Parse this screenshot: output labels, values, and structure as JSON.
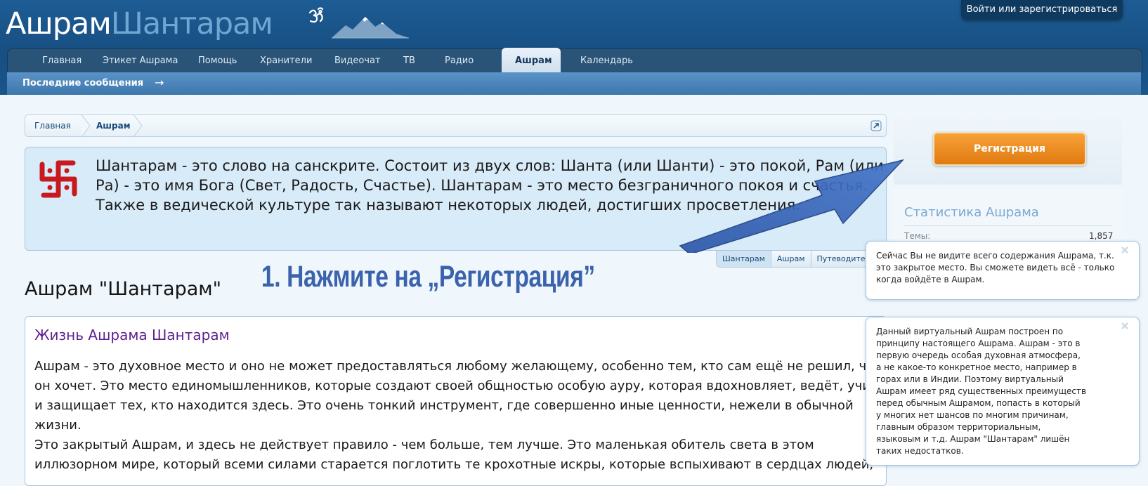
{
  "header": {
    "logo_part1": "Ашрам",
    "logo_part2": "Шантарам",
    "login_link": "Войти или зарегистрироваться"
  },
  "nav": {
    "tabs": [
      {
        "label": "Главная"
      },
      {
        "label": "Этикет Ашрама"
      },
      {
        "label": "Помощь"
      },
      {
        "label": "Хранители"
      },
      {
        "label": "Видеочат"
      },
      {
        "label": "ТВ"
      },
      {
        "label": "Радио"
      },
      {
        "label": "Ашрам"
      },
      {
        "label": "Календарь"
      }
    ],
    "active_tab": "Ашрам"
  },
  "subnav": {
    "item": "Последние сообщения",
    "arrow": "→"
  },
  "breadcrumb": {
    "items": [
      "Главная",
      "Ашрам"
    ]
  },
  "notice": {
    "text": "Шантарам - это слово на санскрите. Состоит из двух слов: Шанта (или Шанти) - это покой, Рам (или Ра) - это имя Бога (Свет, Радость, Счастье). Шантарам - это место безграничного покоя и счастья. Также в ведической культуре так называют некоторых людей, достигших просветления.",
    "tabs": [
      "Шантарам",
      "Ашрам",
      "Путеводитель"
    ]
  },
  "page": {
    "title": "Ашрам \"Шантарам\"",
    "instruction": "1. Нажмите на „Регистрация”"
  },
  "content": {
    "heading": "Жизнь Ашрама Шантарам",
    "paragraph1": "Ашрам - это духовное место и оно не может предоставляться любому желающему, особенно тем, кто сам ещё не решил, что он хочет. Это место единомышленников, которые создают своей общностью особую ауру, которая вдохновляет, ведёт, учит и защищает тех, кто находится здесь. Это очень тонкий инструмент, где совершенно иные ценности, нежели в обычной жизни.",
    "paragraph2": "Это закрытый Ашрам, и здесь не действует правило - чем больше, тем лучше. Это маленькая обитель света в этом иллюзорном мире, который всеми силами старается поглотить те крохотные искры, которые вспыхивают в сердцах людей,"
  },
  "sidebar": {
    "register_button": "Регистрация",
    "stats_title": "Статистика Ашрама",
    "stats_label": "Темы:",
    "stats_value": "1,857"
  },
  "tooltips": [
    {
      "text": "Сейчас Вы не видите всего содержания Ашрама, т.к. это закрытое место. Вы сможете видеть всё - только когда войдёте в Ашрам."
    },
    {
      "text": "Данный виртуальный Ашрам построен по принципу настоящего Ашрама. Ашрам - это в первую очередь особая духовная атмосфера, а не какое-то конкретное место, например в горах или в Индии. Поэтому виртуальный Ашрам имеет ряд существенных преимуществ перед обычным Ашрамом, попасть в который у многих нет шансов по многим причинам, главным образом территориальным, языковым и т.д. Ашрам \"Шантарам\" лишён таких недостатков."
    }
  ],
  "colors": {
    "header_bg": "#1b5a90",
    "logo_accent": "#6fa6d2",
    "register_orange": "#ef8c20",
    "instruction_blue": "#3b62ad",
    "heading_purple": "#5d1f8f",
    "swastika_red": "#c8191e"
  },
  "icons": [
    "om-icon",
    "mountain-icon",
    "expand-icon",
    "swastika-icon",
    "close-icon",
    "arrow-icon"
  ]
}
